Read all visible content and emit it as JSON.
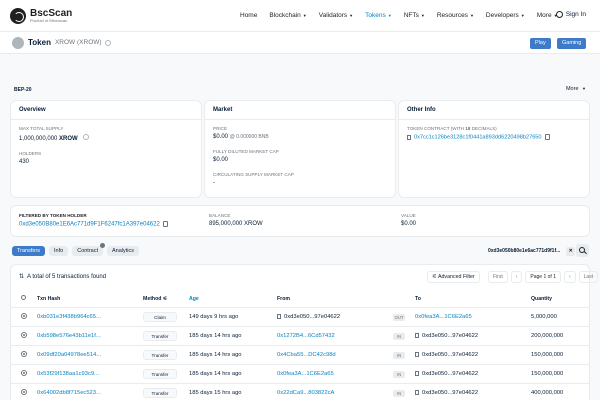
{
  "header": {
    "logo_name": "BscScan",
    "logo_sub": "Product of Etherscan",
    "nav": [
      "Home",
      "Blockchain",
      "Validators",
      "Tokens",
      "NFTs",
      "Resources",
      "Developers",
      "More"
    ],
    "sign_in": "Sign In"
  },
  "token": {
    "label": "Token",
    "name": "XROW (XROW)",
    "buttons": [
      "Play",
      "Gaming"
    ],
    "standard": "BEP-20",
    "more": "More"
  },
  "overview": {
    "title": "Overview",
    "max_supply_label": "MAX TOTAL SUPPLY",
    "max_supply_value": "1,000,000,000",
    "max_supply_symbol": "XROW",
    "holders_label": "HOLDERS",
    "holders_value": "430"
  },
  "market": {
    "title": "Market",
    "price_label": "PRICE",
    "price_value": "$0.00",
    "price_sub": "@ 0.000000 BNB",
    "fdmc_label": "FULLY DILUTED MARKET CAP",
    "fdmc_value": "$0.00",
    "csmc_label": "CIRCULATING SUPPLY MARKET CAP",
    "csmc_value": "-"
  },
  "other": {
    "title": "Other Info",
    "contract_label": "TOKEN CONTRACT (WITH",
    "decimals": "18",
    "decimals_suffix": "DECIMALS)",
    "contract_value": "0x7cc1c126be3128c1f0441a893dd6220498b27650"
  },
  "filter": {
    "label": "FILTERED BY TOKEN HOLDER",
    "address": "0xd3e050B80e1E6Ac771d9F1F6247fc1A397e04622",
    "balance_label": "BALANCE",
    "balance_value": "895,000,000 XROW",
    "value_label": "VALUE",
    "value_value": "$0.00"
  },
  "tabs": [
    "Transfers",
    "Info",
    "Contract",
    "Analytics"
  ],
  "filter_pill": "0xd3e050b80e1e6ac771d9f1f...",
  "summary": "A total of 5 transactions found",
  "advanced_filter": "Advanced Filter",
  "pager": {
    "first": "First",
    "page": "Page 1 of 1",
    "last": "Last"
  },
  "columns": [
    "Txn Hash",
    "Method",
    "Age",
    "From",
    "To",
    "Quantity"
  ],
  "rows": [
    {
      "hash": "0xb031e3f438b964c65...",
      "method": "Claim",
      "age": "149 days 9 hrs ago",
      "from": "0xd3e050...97e04622",
      "dir": "OUT",
      "to": "0x0fea3A...1C6E2a65",
      "qty": "5,000,000"
    },
    {
      "hash": "0xb598e576e43b11e1f...",
      "method": "Transfer",
      "age": "185 days 14 hrs ago",
      "from": "0x1272B4...6Cd57432",
      "dir": "IN",
      "to": "0xd3e050...97e04622",
      "qty": "200,000,000"
    },
    {
      "hash": "0x09df20a04978ee514...",
      "method": "Transfer",
      "age": "185 days 14 hrs ago",
      "from": "0x4Cba55...DC42c98d",
      "dir": "IN",
      "to": "0xd3e050...97e04622",
      "qty": "150,000,000"
    },
    {
      "hash": "0x53f29f138aa1c93c9...",
      "method": "Transfer",
      "age": "185 days 14 hrs ago",
      "from": "0x0fea3A...1C6E2a65",
      "dir": "IN",
      "to": "0xd3e050...97e04622",
      "qty": "150,000,000"
    },
    {
      "hash": "0x64002db8f715ec523...",
      "method": "Transfer",
      "age": "185 days 15 hrs ago",
      "from": "0x22dCa9...803822cA",
      "dir": "IN",
      "to": "0xd3e050...97e04622",
      "qty": "400,000,000"
    }
  ],
  "colors": {
    "accent": "#0784c3",
    "button": "#3d7ac9"
  }
}
